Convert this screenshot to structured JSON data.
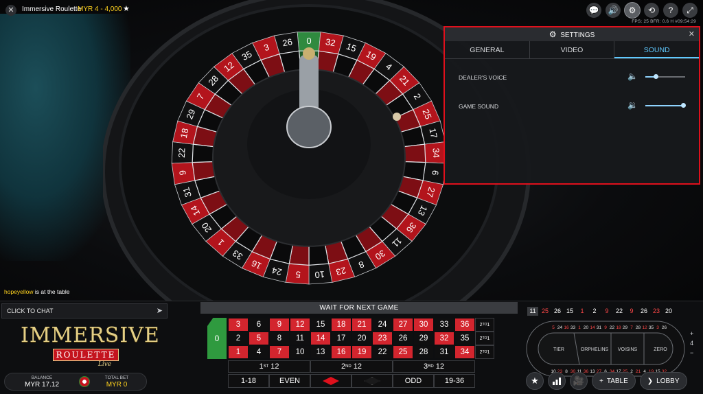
{
  "header": {
    "title": "Immersive Roulette",
    "limits": "MYR 4 - 4,000",
    "fps": "FPS: 25  BFR: 0.6   H    #09:54:29"
  },
  "icons": {
    "close": "✕",
    "favorite": "★",
    "chat_bubbles": "💬",
    "volume": "🔊",
    "settings": "⚙",
    "history": "⟲",
    "help": "?",
    "fullscreen": "⤢"
  },
  "settings": {
    "title": "SETTINGS",
    "close": "✕",
    "tabs": [
      {
        "label": "GENERAL",
        "active": false
      },
      {
        "label": "VIDEO",
        "active": false
      },
      {
        "label": "SOUND",
        "active": true
      }
    ],
    "rows": [
      {
        "label": "DEALER'S VOICE",
        "level": 0.25
      },
      {
        "label": "GAME SOUND",
        "level": 0.95
      }
    ],
    "accent_color": "#5fc9ff",
    "border_color": "#e0101c"
  },
  "notification": {
    "user": "hopeyellow",
    "text": " is at the table"
  },
  "chat": {
    "label": "CLICK TO CHAT",
    "send_icon": "➤"
  },
  "logo": {
    "main": "IMMERSIVE",
    "sub": "ROULETTE",
    "live": "Live"
  },
  "balance": {
    "balance_label": "BALANCE",
    "balance_value": "MYR 17.12",
    "bet_label": "TOTAL BET",
    "bet_value": "MYR 0"
  },
  "table": {
    "status": "WAIT FOR NEXT GAME",
    "zero": "0",
    "rows": [
      [
        {
          "n": "3",
          "c": "red"
        },
        {
          "n": "6",
          "c": "black"
        },
        {
          "n": "9",
          "c": "red"
        },
        {
          "n": "12",
          "c": "red"
        },
        {
          "n": "15",
          "c": "black"
        },
        {
          "n": "18",
          "c": "red"
        },
        {
          "n": "21",
          "c": "red"
        },
        {
          "n": "24",
          "c": "black"
        },
        {
          "n": "27",
          "c": "red"
        },
        {
          "n": "30",
          "c": "red"
        },
        {
          "n": "33",
          "c": "black"
        },
        {
          "n": "36",
          "c": "red"
        }
      ],
      [
        {
          "n": "2",
          "c": "black"
        },
        {
          "n": "5",
          "c": "red"
        },
        {
          "n": "8",
          "c": "black"
        },
        {
          "n": "11",
          "c": "black"
        },
        {
          "n": "14",
          "c": "red"
        },
        {
          "n": "17",
          "c": "black"
        },
        {
          "n": "20",
          "c": "black"
        },
        {
          "n": "23",
          "c": "red"
        },
        {
          "n": "26",
          "c": "black"
        },
        {
          "n": "29",
          "c": "black"
        },
        {
          "n": "32",
          "c": "red"
        },
        {
          "n": "35",
          "c": "black"
        }
      ],
      [
        {
          "n": "1",
          "c": "red"
        },
        {
          "n": "4",
          "c": "black"
        },
        {
          "n": "7",
          "c": "red"
        },
        {
          "n": "10",
          "c": "black"
        },
        {
          "n": "13",
          "c": "black"
        },
        {
          "n": "16",
          "c": "red"
        },
        {
          "n": "19",
          "c": "red"
        },
        {
          "n": "22",
          "c": "black"
        },
        {
          "n": "25",
          "c": "red"
        },
        {
          "n": "28",
          "c": "black"
        },
        {
          "n": "31",
          "c": "black"
        },
        {
          "n": "34",
          "c": "red"
        }
      ]
    ],
    "column_bet": "2TO1",
    "dozens": [
      "1ST 12",
      "2ND 12",
      "3RD 12"
    ],
    "outside": [
      "1-18",
      "EVEN",
      "",
      "",
      "ODD",
      "19-36"
    ]
  },
  "history": [
    {
      "n": "11",
      "c": "white",
      "latest": true
    },
    {
      "n": "25",
      "c": "red"
    },
    {
      "n": "26",
      "c": "white"
    },
    {
      "n": "15",
      "c": "white"
    },
    {
      "n": "1",
      "c": "red"
    },
    {
      "n": "2",
      "c": "white"
    },
    {
      "n": "9",
      "c": "red"
    },
    {
      "n": "22",
      "c": "white"
    },
    {
      "n": "9",
      "c": "red"
    },
    {
      "n": "26",
      "c": "white"
    },
    {
      "n": "23",
      "c": "red"
    },
    {
      "n": "20",
      "c": "white"
    }
  ],
  "racetrack": {
    "top": [
      "5",
      "24",
      "16",
      "33",
      "1",
      "20",
      "14",
      "31",
      "9",
      "22",
      "18",
      "29",
      "7",
      "28",
      "12",
      "35",
      "3",
      "26"
    ],
    "bottom": [
      "10",
      "23",
      "8",
      "30",
      "11",
      "36",
      "13",
      "27",
      "6",
      "34",
      "17",
      "25",
      "2",
      "21",
      "4",
      "19",
      "15",
      "32"
    ],
    "sections": [
      "TIER",
      "ORPHELINS",
      "VOISINS",
      "ZERO"
    ],
    "neighbours": "4"
  },
  "actions": {
    "favorites_icon": "★",
    "stats_icon": "▮",
    "video_icon": "🎥",
    "table_label": "TABLE",
    "lobby_label": "LOBBY"
  },
  "wheel": {
    "numbers": [
      "0",
      "32",
      "15",
      "19",
      "4",
      "21",
      "2",
      "25",
      "17",
      "34",
      "6",
      "27",
      "13",
      "36",
      "11",
      "30",
      "8",
      "23",
      "10",
      "5",
      "24",
      "16",
      "33",
      "1",
      "20",
      "14",
      "31",
      "9",
      "22",
      "18",
      "29",
      "7",
      "28",
      "12",
      "35",
      "3",
      "26"
    ]
  }
}
